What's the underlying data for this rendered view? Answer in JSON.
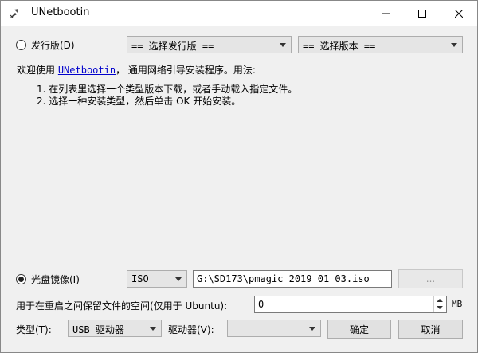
{
  "window": {
    "title": "UNetbootin"
  },
  "distribution": {
    "radio_label": "发行版(D)",
    "distro_value": "== 选择发行版 ==",
    "version_value": "== 选择版本 =="
  },
  "info": {
    "prefix": "欢迎使用 ",
    "link": "UNetbootin",
    "suffix": "， 通用网络引导安装程序。用法:",
    "steps": [
      "1. 在列表里选择一个类型版本下载，或者手动载入指定文件。",
      "2. 选择一种安装类型，然后单击 OK 开始安装。"
    ]
  },
  "diskimage": {
    "radio_label": "光盘镜像(I)",
    "type_value": "ISO",
    "path_value": "G:\\SD173\\pmagic_2019_01_03.iso",
    "browse_label": "..."
  },
  "persistence": {
    "label": "用于在重启之间保留文件的空间(仅用于 Ubuntu):",
    "value": "0",
    "unit": "MB"
  },
  "footer": {
    "type_label": "类型(T):",
    "type_value": "USB 驱动器",
    "drive_label": "驱动器(V):",
    "drive_value": "",
    "ok_label": "确定",
    "cancel_label": "取消"
  }
}
